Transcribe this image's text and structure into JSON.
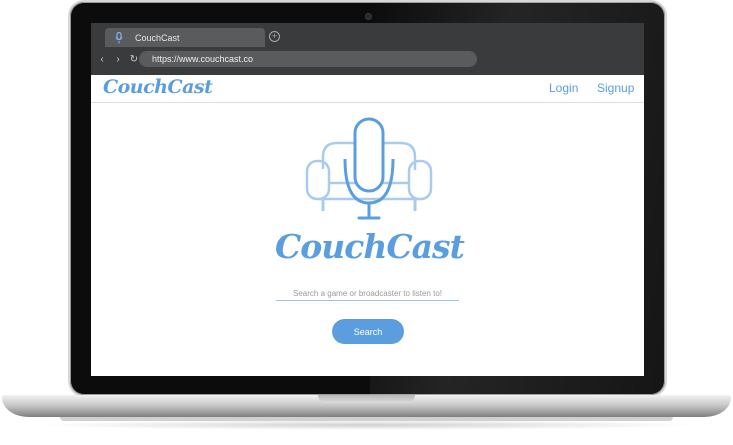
{
  "browser": {
    "tab_title": "CouchCast",
    "new_tab_icon": "plus-circle-icon",
    "url": "https://www.couchcast.co",
    "nav_icons": [
      "back-arrow-icon",
      "forward-arrow-icon",
      "reload-icon"
    ]
  },
  "header": {
    "brand": "CouchCast",
    "login_label": "Login",
    "signup_label": "Signup"
  },
  "hero": {
    "logo_icon": "couch-microphone-icon",
    "brand": "CouchCast",
    "search_placeholder": "Search a game or broadcaster to listen to!",
    "search_button_label": "Search"
  },
  "colors": {
    "brand_blue": "#5b9ee0",
    "light_blue": "#a9cbee",
    "chrome_dark": "#3a3b3d"
  }
}
